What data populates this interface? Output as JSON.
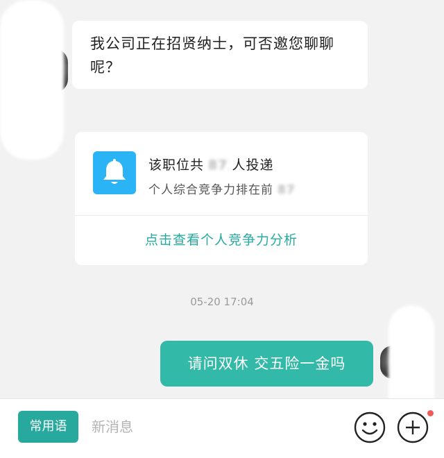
{
  "messages": {
    "recruiter_text": "我公司正在招贤纳士，可否邀您聊聊呢？",
    "self_text": "请问双休 交五险一金吗"
  },
  "card": {
    "line1_prefix": "该职位共",
    "line1_number": "87",
    "line1_suffix": "人投递",
    "line2_prefix": "个人综合竞争力排在前",
    "line2_number": "87",
    "link_text": "点击查看个人竞争力分析",
    "icon": "bell-icon"
  },
  "timestamp": "05-20 17:04",
  "composer": {
    "phrases_label": "常用语",
    "placeholder": "新消息",
    "emoji_icon": "smiley-icon",
    "more_icon": "plus-icon"
  },
  "colors": {
    "accent": "#27a99d",
    "bubble_self": "#33b9a8",
    "bell_bg": "#2ab3f5",
    "notification_dot": "#f05a5a"
  }
}
